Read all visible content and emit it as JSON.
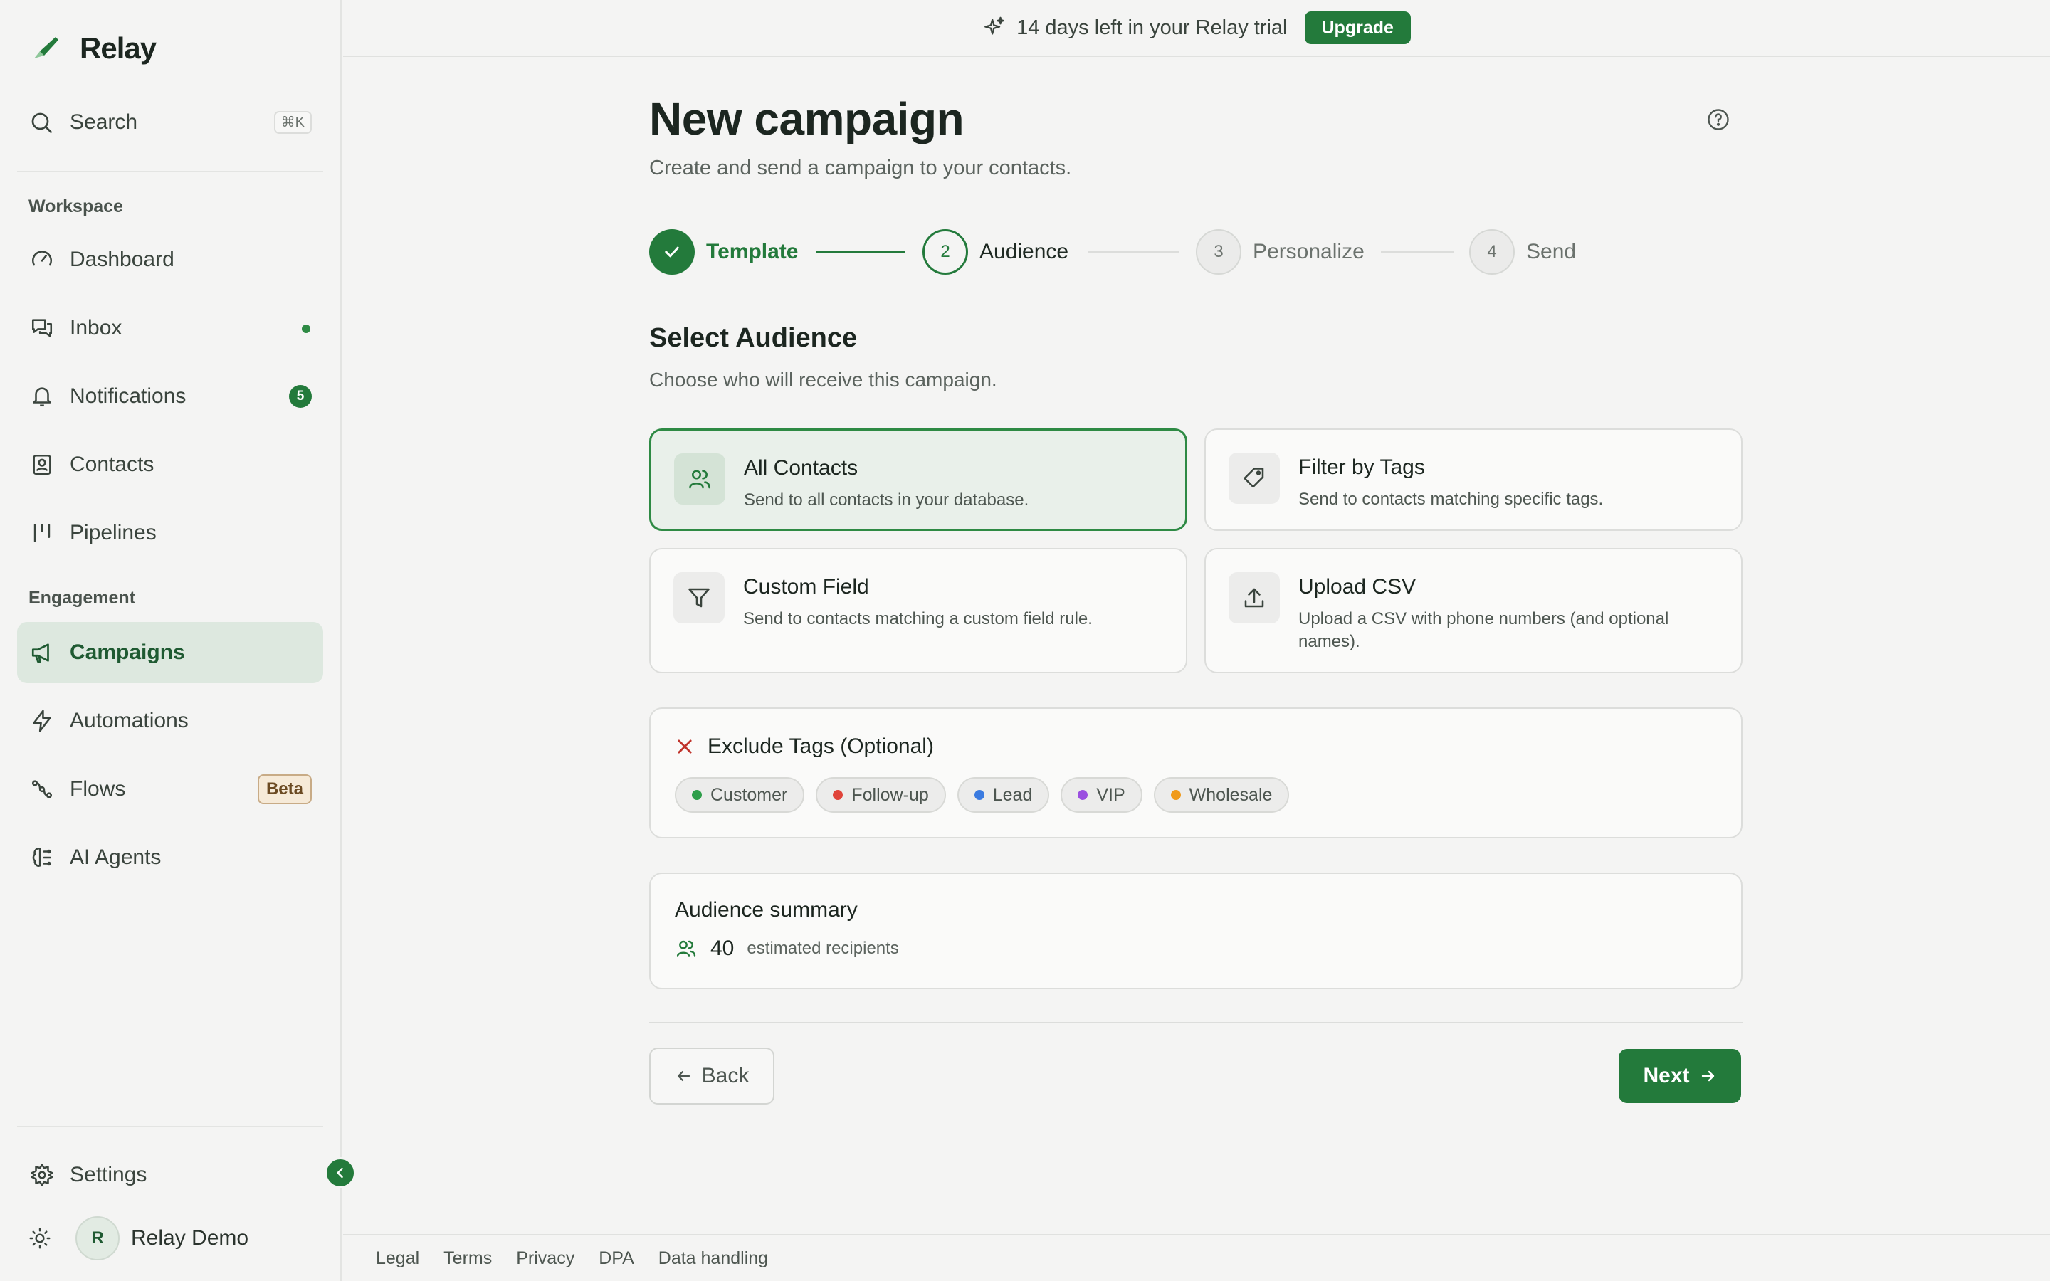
{
  "app": {
    "name": "Relay"
  },
  "sidebar": {
    "search": {
      "label": "Search",
      "shortcut": "⌘K"
    },
    "workspace_label": "Workspace",
    "engagement_label": "Engagement",
    "items": [
      {
        "label": "Dashboard",
        "icon": "gauge-icon"
      },
      {
        "label": "Inbox",
        "icon": "chat-icon",
        "indicator": "unread-dot"
      },
      {
        "label": "Notifications",
        "icon": "bell-icon",
        "badge": "5"
      },
      {
        "label": "Contacts",
        "icon": "contact-book-icon"
      },
      {
        "label": "Pipelines",
        "icon": "pipeline-icon"
      },
      {
        "label": "Campaigns",
        "icon": "megaphone-icon",
        "active": true
      },
      {
        "label": "Automations",
        "icon": "lightning-icon"
      },
      {
        "label": "Flows",
        "icon": "flow-icon",
        "badge": "Beta"
      },
      {
        "label": "AI Agents",
        "icon": "brain-icon"
      }
    ],
    "settings_label": "Settings",
    "user": {
      "initial": "R",
      "name": "Relay Demo"
    }
  },
  "banner": {
    "text": "14 days left in your Relay trial",
    "button": "Upgrade"
  },
  "page": {
    "title": "New campaign",
    "subtitle": "Create and send a campaign to your contacts."
  },
  "steps": [
    {
      "number": "1",
      "label": "Template",
      "state": "done"
    },
    {
      "number": "2",
      "label": "Audience",
      "state": "current"
    },
    {
      "number": "3",
      "label": "Personalize",
      "state": "todo"
    },
    {
      "number": "4",
      "label": "Send",
      "state": "todo"
    }
  ],
  "audience": {
    "title": "Select Audience",
    "subtitle": "Choose who will receive this campaign.",
    "options": [
      {
        "title": "All Contacts",
        "description": "Send to all contacts in your database.",
        "icon": "users-icon",
        "selected": true
      },
      {
        "title": "Filter by Tags",
        "description": "Send to contacts matching specific tags.",
        "icon": "tag-icon",
        "selected": false
      },
      {
        "title": "Custom Field",
        "description": "Send to contacts matching a custom field rule.",
        "icon": "filter-icon",
        "selected": false
      },
      {
        "title": "Upload CSV",
        "description": "Upload a CSV with phone numbers (and optional names).",
        "icon": "upload-icon",
        "selected": false
      }
    ]
  },
  "exclude": {
    "title": "Exclude Tags (Optional)",
    "tags": [
      {
        "label": "Customer",
        "color": "#2e9e4a"
      },
      {
        "label": "Follow-up",
        "color": "#e0443a"
      },
      {
        "label": "Lead",
        "color": "#3b7be0"
      },
      {
        "label": "VIP",
        "color": "#9b4fe0"
      },
      {
        "label": "Wholesale",
        "color": "#f09a1a"
      }
    ]
  },
  "summary": {
    "title": "Audience summary",
    "count": "40",
    "label": "estimated recipients"
  },
  "actions": {
    "back": "Back",
    "next": "Next"
  },
  "footer": {
    "links": [
      "Legal",
      "Terms",
      "Privacy",
      "DPA",
      "Data handling"
    ]
  },
  "colors": {
    "accent": "#237a3b",
    "selected_bg": "#e9f0ea",
    "background": "#f4f4f3"
  }
}
